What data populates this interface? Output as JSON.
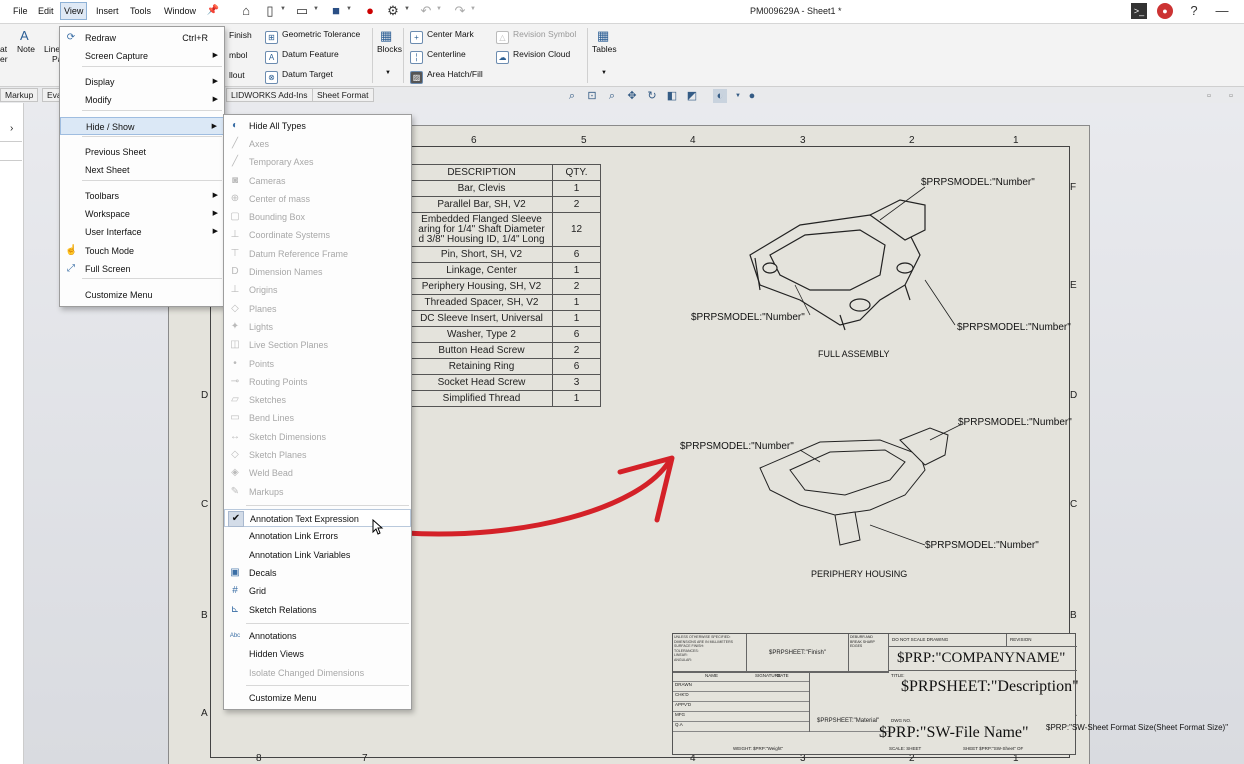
{
  "menubar": {
    "items": [
      "File",
      "Edit",
      "View",
      "Insert",
      "Tools",
      "Window"
    ],
    "active": "View"
  },
  "document_title": "PM009629A - Sheet1 *",
  "ribbon": {
    "left_partial": [
      "at",
      "er"
    ],
    "note_label": "Note",
    "line_label": "Line",
    "pa_label": "Pa",
    "items": [
      {
        "label": "Finish",
        "disabled": false
      },
      {
        "label": "mbol",
        "disabled": false
      },
      {
        "label": "llout",
        "disabled": false
      },
      {
        "label": "Geometric Tolerance",
        "disabled": false
      },
      {
        "label": "Datum Feature",
        "disabled": false
      },
      {
        "label": "Datum Target",
        "disabled": false
      },
      {
        "label": "Blocks",
        "disabled": false
      },
      {
        "label": "Center Mark",
        "disabled": false
      },
      {
        "label": "Centerline",
        "disabled": false
      },
      {
        "label": "Area Hatch/Fill",
        "disabled": false
      },
      {
        "label": "Revision Symbol",
        "disabled": true
      },
      {
        "label": "Revision Cloud",
        "disabled": false
      },
      {
        "label": "Tables",
        "disabled": false
      }
    ]
  },
  "tabs": [
    "Markup",
    "Eva",
    "LIDWORKS Add-Ins",
    "Sheet Format"
  ],
  "view_menu": {
    "items": [
      {
        "label": "Redraw",
        "shortcut": "Ctrl+R",
        "submenu": false,
        "icon": "redraw-icon"
      },
      {
        "label": "Screen Capture",
        "shortcut": "",
        "submenu": true,
        "icon": ""
      },
      {
        "label": "Display",
        "shortcut": "",
        "submenu": true,
        "icon": ""
      },
      {
        "label": "Modify",
        "shortcut": "",
        "submenu": true,
        "icon": ""
      },
      {
        "label": "Hide / Show",
        "shortcut": "",
        "submenu": true,
        "icon": "",
        "highlighted": true
      },
      {
        "label": "Previous Sheet",
        "shortcut": "",
        "submenu": false,
        "icon": ""
      },
      {
        "label": "Next Sheet",
        "shortcut": "",
        "submenu": false,
        "icon": ""
      },
      {
        "label": "Toolbars",
        "shortcut": "",
        "submenu": true,
        "icon": ""
      },
      {
        "label": "Workspace",
        "shortcut": "",
        "submenu": true,
        "icon": ""
      },
      {
        "label": "User Interface",
        "shortcut": "",
        "submenu": true,
        "icon": ""
      },
      {
        "label": "Touch Mode",
        "shortcut": "",
        "submenu": false,
        "icon": "touch-icon"
      },
      {
        "label": "Full Screen",
        "shortcut": "",
        "submenu": false,
        "icon": "fullscreen-icon"
      },
      {
        "label": "Customize Menu",
        "shortcut": "",
        "submenu": false,
        "icon": ""
      }
    ]
  },
  "hide_show_menu": {
    "items": [
      {
        "label": "Hide All Types",
        "disabled": false
      },
      {
        "label": "Axes",
        "disabled": true
      },
      {
        "label": "Temporary Axes",
        "disabled": true
      },
      {
        "label": "Cameras",
        "disabled": true
      },
      {
        "label": "Center of mass",
        "disabled": true
      },
      {
        "label": "Bounding Box",
        "disabled": true
      },
      {
        "label": "Coordinate Systems",
        "disabled": true
      },
      {
        "label": "Datum Reference Frame",
        "disabled": true
      },
      {
        "label": "Dimension Names",
        "disabled": true
      },
      {
        "label": "Origins",
        "disabled": true
      },
      {
        "label": "Planes",
        "disabled": true
      },
      {
        "label": "Lights",
        "disabled": true
      },
      {
        "label": "Live Section Planes",
        "disabled": true
      },
      {
        "label": "Points",
        "disabled": true
      },
      {
        "label": "Routing Points",
        "disabled": true
      },
      {
        "label": "Sketches",
        "disabled": true
      },
      {
        "label": "Bend Lines",
        "disabled": true
      },
      {
        "label": "Sketch Dimensions",
        "disabled": true
      },
      {
        "label": "Sketch Planes",
        "disabled": true
      },
      {
        "label": "Weld Bead",
        "disabled": true
      },
      {
        "label": "Markups",
        "disabled": true
      },
      {
        "label": "Annotation Text Expression",
        "disabled": false,
        "checked": true
      },
      {
        "label": "Annotation Link Errors",
        "disabled": false
      },
      {
        "label": "Annotation Link Variables",
        "disabled": false
      },
      {
        "label": "Decals",
        "disabled": false
      },
      {
        "label": "Grid",
        "disabled": false
      },
      {
        "label": "Sketch Relations",
        "disabled": false
      },
      {
        "label": "Annotations",
        "disabled": false
      },
      {
        "label": "Hidden Views",
        "disabled": false
      },
      {
        "label": "Isolate Changed Dimensions",
        "disabled": true
      },
      {
        "label": "Customize Menu",
        "disabled": false
      }
    ]
  },
  "zones": {
    "top": [
      "6",
      "5",
      "4",
      "3",
      "2",
      "1"
    ],
    "bottom": [
      "8",
      "7",
      "4",
      "3",
      "2",
      "1"
    ],
    "left": [
      "D",
      "C",
      "B",
      "A"
    ],
    "right": [
      "F",
      "E",
      "D",
      "C",
      "B",
      "A"
    ]
  },
  "bom": {
    "headers": [
      "DESCRIPTION",
      "QTY."
    ],
    "rows": [
      {
        "desc": "Bar, Clevis",
        "qty": "1"
      },
      {
        "desc": "Parallel Bar, SH, V2",
        "qty": "2"
      },
      {
        "desc": "Embedded Flanged Sleeve\naring for 1/4\" Shaft Diameter\nd 3/8\" Housing ID, 1/4\" Long",
        "qty": "12"
      },
      {
        "desc": "Pin, Short, SH, V2",
        "qty": "6"
      },
      {
        "desc": "Linkage, Center",
        "qty": "1"
      },
      {
        "desc": "Periphery Housing, SH, V2",
        "qty": "2"
      },
      {
        "desc": "Threaded Spacer, SH, V2",
        "qty": "1"
      },
      {
        "desc": "DC Sleeve Insert, Universal",
        "qty": "1"
      },
      {
        "desc": "Washer, Type 2",
        "qty": "6"
      },
      {
        "desc": "Button Head Screw",
        "qty": "2"
      },
      {
        "desc": "Retaining Ring",
        "qty": "6"
      },
      {
        "desc": "Socket Head Screw",
        "qty": "3"
      },
      {
        "desc": "Simplified Thread",
        "qty": "1"
      }
    ]
  },
  "notes": {
    "balloon1": "$PRPSMODEL:\"Number\"",
    "balloon2": "$PRPSMODEL:\"Number\"",
    "balloon3": "$PRPSMODEL:\"Number\"",
    "balloon4": "$PRPSMODEL:\"Number\"",
    "balloon5": "$PRPSMODEL:\"Number\"",
    "balloon6": "$PRPSMODEL:\"Number\"",
    "view1_label": "FULL ASSEMBLY",
    "view2_label": "PERIPHERY HOUSING"
  },
  "title_block": {
    "finish": "$PRPSHEET:\"Finish\"",
    "do_not_scale": "DO NOT SCALE DRAWING",
    "revision": "REVISION",
    "company": "$PRP:\"COMPANYNAME\"",
    "title_label": "TITLE:",
    "description": "$PRPSHEET:\"Description\"",
    "material": "$PRPSHEET:\"Material\"",
    "dwg_no": "DWG NO.",
    "filename": "$PRP:\"SW-File Name\"",
    "sheet_format": "$PRP:\"SW-Sheet Format Size(Sheet Format Size)\"",
    "name_col": "NAME",
    "sig_col": "SIGNATURE",
    "date_col": "DATE",
    "rows": [
      "DRAWN",
      "CHK'D",
      "APPV'D",
      "MFG",
      "Q.A"
    ],
    "weight": "WEIGHT: $PRP:\"Weight\"",
    "scale": "SCALE: SHEET",
    "sheet": "SHEET $PRP:\"SW-Sheet\" OF"
  }
}
